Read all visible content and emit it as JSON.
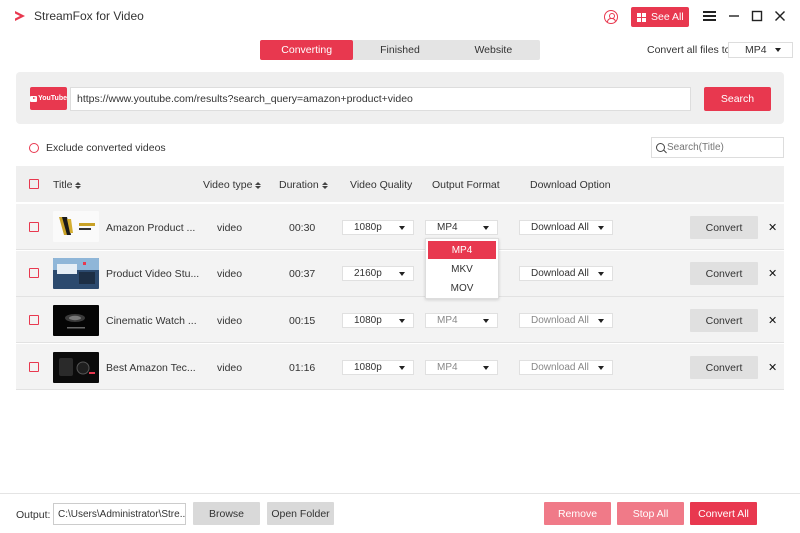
{
  "app": {
    "title": "StreamFox for Video",
    "see_all_label": "See All",
    "accent_color": "#e8384f"
  },
  "tabs": [
    {
      "label": "Converting",
      "active": true
    },
    {
      "label": "Finished",
      "active": false
    },
    {
      "label": "Website",
      "active": false
    }
  ],
  "convert_all": {
    "label": "Convert all files to:",
    "value": "MP4"
  },
  "url_bar": {
    "source_badge": "YouTube",
    "url": "https://www.youtube.com/results?search_query=amazon+product+video",
    "search_label": "Search"
  },
  "filter": {
    "exclude_label": "Exclude converted videos",
    "search_placeholder": "Search(Title)"
  },
  "table": {
    "headers": {
      "title": "Title",
      "video_type": "Video type",
      "duration": "Duration",
      "video_quality": "Video Quality",
      "output_format": "Output Format",
      "download_option": "Download Option"
    },
    "rows": [
      {
        "title": "Amazon Product ...",
        "type": "video",
        "duration": "00:30",
        "quality": "1080p",
        "format": "MP4",
        "download": "Download All",
        "convert": "Convert"
      },
      {
        "title": "Product Video Stu...",
        "type": "video",
        "duration": "00:37",
        "quality": "2160p",
        "format": "MP4",
        "download": "Download All",
        "convert": "Convert"
      },
      {
        "title": "Cinematic Watch ...",
        "type": "video",
        "duration": "00:15",
        "quality": "1080p",
        "format": "MP4",
        "download": "Download All",
        "convert": "Convert"
      },
      {
        "title": "Best Amazon Tec...",
        "type": "video",
        "duration": "01:16",
        "quality": "1080p",
        "format": "MP4",
        "download": "Download All",
        "convert": "Convert"
      }
    ]
  },
  "format_dropdown": {
    "options": [
      "MP4",
      "MKV",
      "MOV"
    ],
    "selected": "MP4"
  },
  "footer": {
    "output_label": "Output:",
    "output_path": "C:\\Users\\Administrator\\Stre...",
    "browse_label": "Browse",
    "open_folder_label": "Open Folder",
    "remove_label": "Remove",
    "stop_all_label": "Stop All",
    "convert_all_label": "Convert All"
  }
}
